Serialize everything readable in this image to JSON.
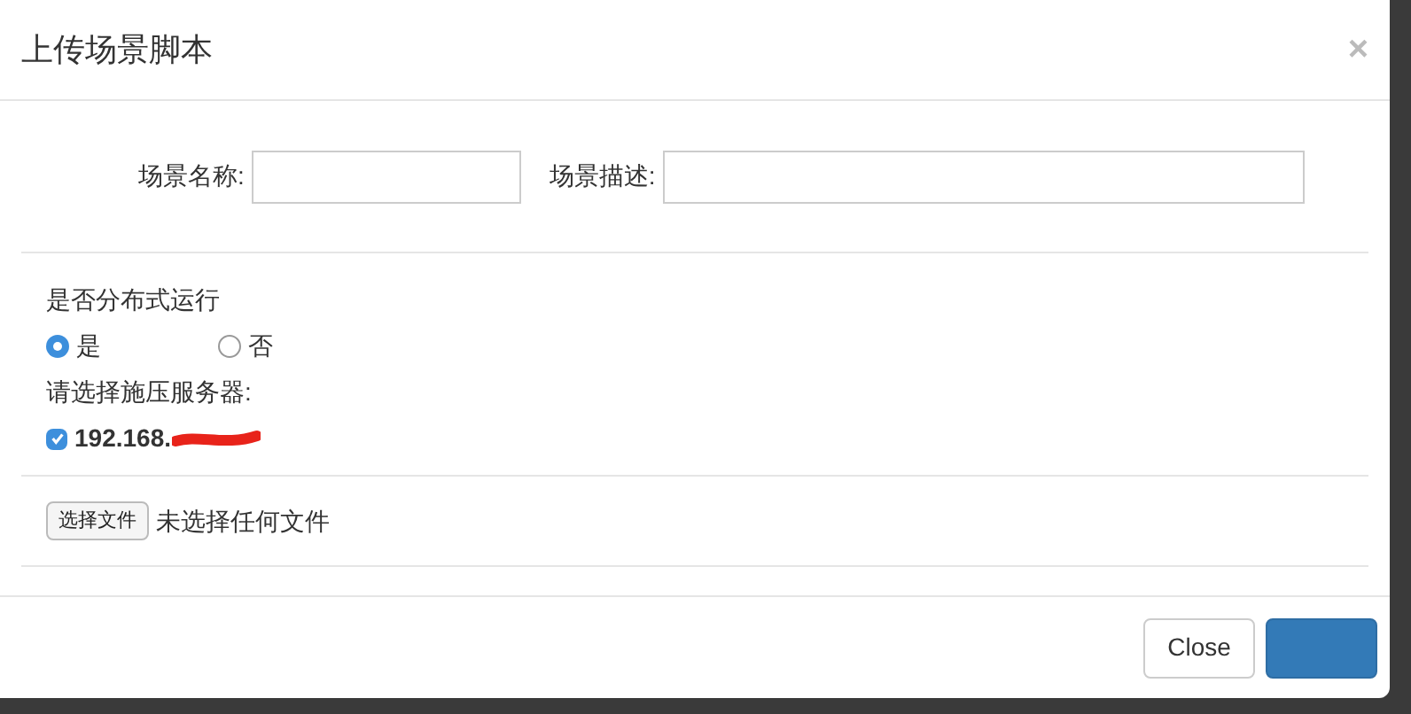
{
  "modal": {
    "title": "上传场景脚本",
    "close": "×"
  },
  "fields": [
    {
      "label": "场景名称:"
    },
    {
      "label": "场景描述:"
    }
  ],
  "distributed": {
    "label": "是否分布式运行",
    "options": [
      {
        "label": "是",
        "selected": true
      },
      {
        "label": "否",
        "selected": false
      }
    ]
  },
  "servers": {
    "label": "请选择施压服务器:",
    "items": [
      {
        "label": "192.168.",
        "checked": true,
        "redacted": true
      }
    ]
  },
  "file": {
    "button": "选择文件",
    "status": "未选择任何文件"
  },
  "footer": {
    "buttons": [
      {
        "label": "Close",
        "kind": "default"
      },
      {
        "kind": "primary"
      }
    ]
  }
}
